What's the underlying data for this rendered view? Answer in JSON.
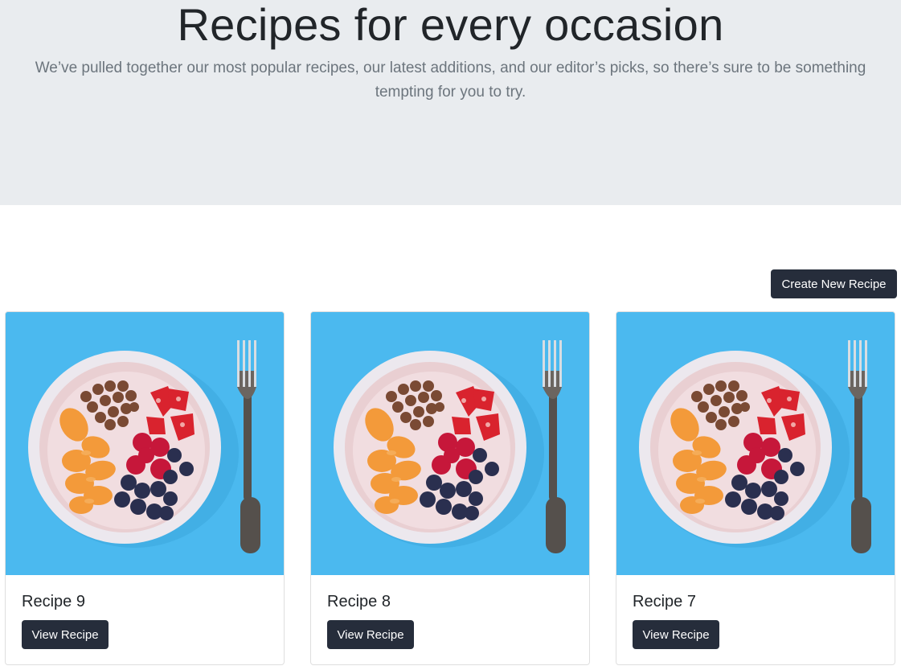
{
  "hero": {
    "title": "Recipes for every occasion",
    "lead": "We’ve pulled together our most popular recipes, our latest additions, and our editor’s picks, so there’s sure to be something tempting for you to try."
  },
  "actions": {
    "create_label": "Create New Recipe"
  },
  "recipes": [
    {
      "title": "Recipe 9",
      "button_label": "View Recipe",
      "image": "fruit-bowl-photo"
    },
    {
      "title": "Recipe 8",
      "button_label": "View Recipe",
      "image": "fruit-bowl-photo"
    },
    {
      "title": "Recipe 7",
      "button_label": "View Recipe",
      "image": "fruit-bowl-photo"
    }
  ],
  "colors": {
    "hero_bg": "#e9ecef",
    "button_bg": "#262d3b",
    "photo_bg": "#4bb9ef"
  }
}
